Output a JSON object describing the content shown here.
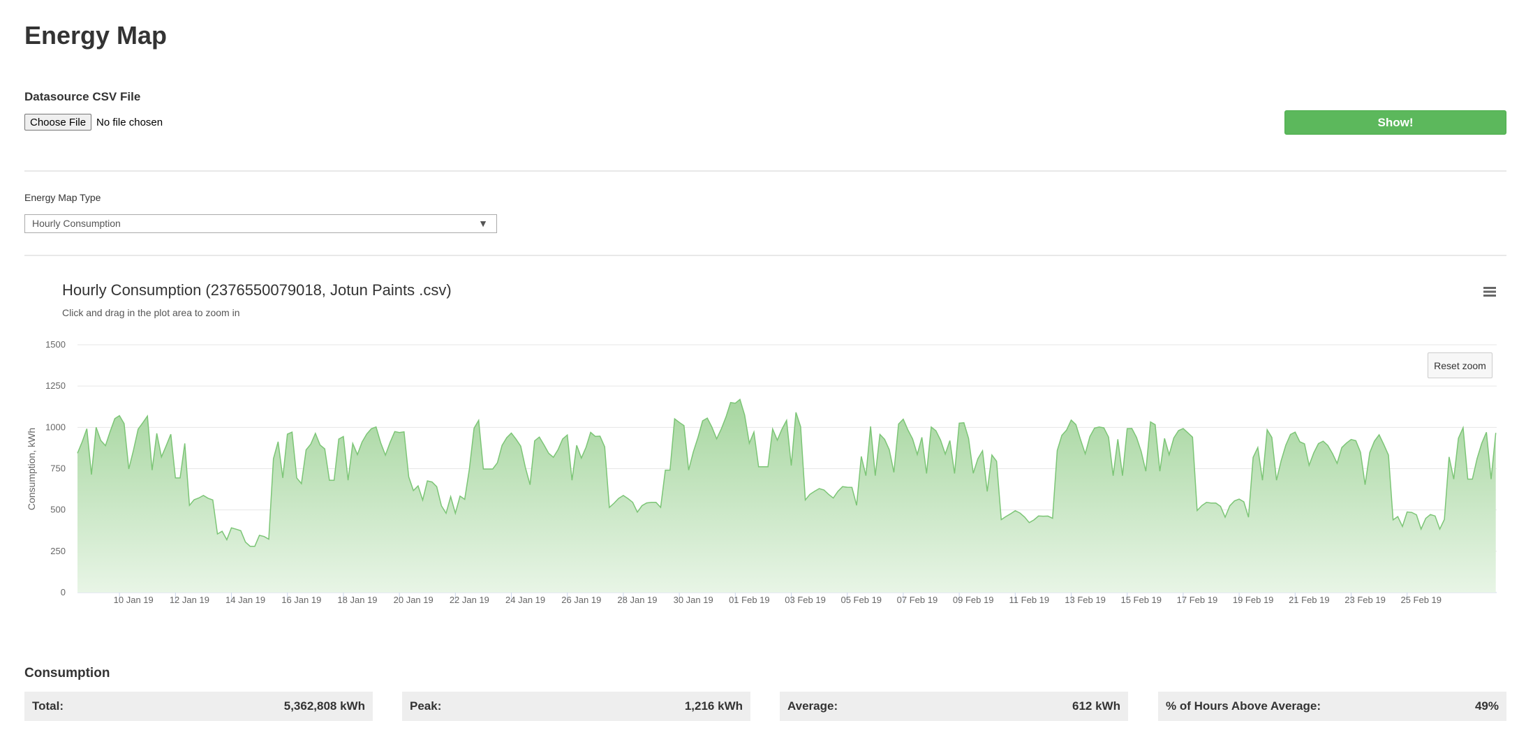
{
  "page": {
    "title": "Energy Map"
  },
  "datasource": {
    "label": "Datasource CSV File",
    "choose_button": "Choose File",
    "file_status": "No file chosen",
    "show_button": "Show!"
  },
  "map_type": {
    "label": "Energy Map Type",
    "selected": "Hourly Consumption",
    "arrow": "▼"
  },
  "chart": {
    "menu_icon": "hamburger-menu-icon",
    "reset_zoom": "Reset zoom",
    "fill_color": "#a9d8a4",
    "line_color": "#7cc576"
  },
  "chart_data": {
    "type": "area",
    "title": "Hourly Consumption (2376550079018, Jotun Paints .csv)",
    "subtitle": "Click and drag in the plot area to zoom in",
    "ylabel": "Consumption, kWh",
    "xlabel": "",
    "ylim": [
      0,
      1500
    ],
    "yticks": [
      "0",
      "250",
      "500",
      "750",
      "1000",
      "1250",
      "1500"
    ],
    "xticks": [
      "10 Jan 19",
      "12 Jan 19",
      "14 Jan 19",
      "16 Jan 19",
      "18 Jan 19",
      "20 Jan 19",
      "22 Jan 19",
      "24 Jan 19",
      "26 Jan 19",
      "28 Jan 19",
      "30 Jan 19",
      "01 Feb 19",
      "03 Feb 19",
      "05 Feb 19",
      "07 Feb 19",
      "09 Feb 19",
      "11 Feb 19",
      "13 Feb 19",
      "15 Feb 19",
      "17 Feb 19",
      "19 Feb 19",
      "21 Feb 19",
      "23 Feb 19",
      "25 Feb 19"
    ],
    "grid": true,
    "legend": "none",
    "x_start": "08 Jan 19",
    "x_end": "27 Feb 19",
    "daily_peaks_kwh": [
      1050,
      1100,
      1090,
      1020,
      600,
      400,
      350,
      1020,
      970,
      1000,
      1040,
      1030,
      700,
      600,
      1100,
      980,
      960,
      1000,
      1000,
      590,
      560,
      1090,
      1070,
      1210,
      1120,
      1130,
      640,
      660,
      1040,
      1070,
      1060,
      1060,
      900,
      500,
      480,
      1050,
      1060,
      1040,
      1080,
      1050,
      560,
      570,
      1000,
      990,
      960,
      980,
      960,
      500,
      480,
      1010,
      1010,
      1030,
      1040,
      1050
    ]
  },
  "consumption": {
    "title": "Consumption",
    "stats": [
      {
        "label": "Total:",
        "value": "5,362,808 kWh"
      },
      {
        "label": "Peak:",
        "value": "1,216 kWh"
      },
      {
        "label": "Average:",
        "value": "612 kWh"
      },
      {
        "label": "% of Hours Above Average:",
        "value": "49%"
      }
    ]
  }
}
